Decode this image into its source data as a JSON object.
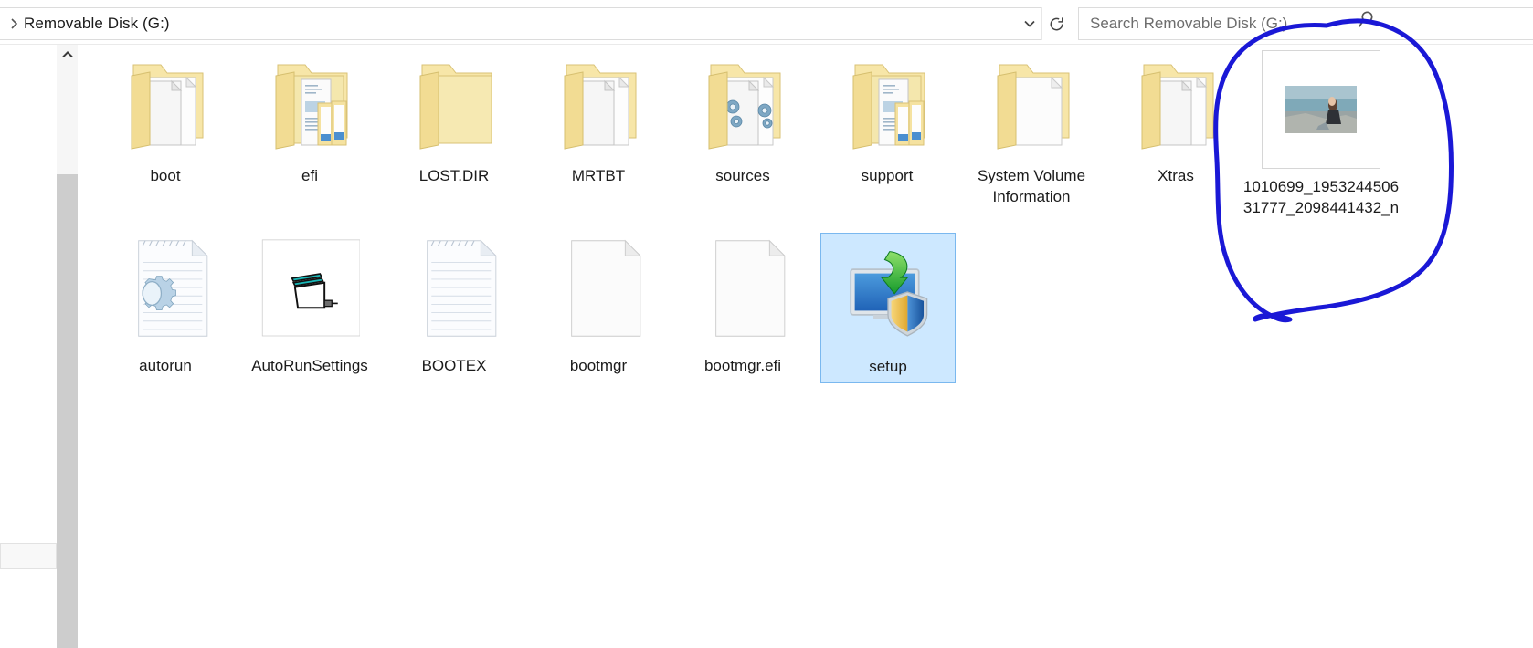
{
  "window": {
    "address": {
      "path_label": "Removable Disk (G:)",
      "expand_icon": "chevron-right-icon",
      "dropdown_icon": "chevron-down-icon",
      "refresh_icon": "refresh-icon"
    },
    "search": {
      "placeholder": "Search Removable Disk (G:)",
      "value": "",
      "icon": "search-icon"
    }
  },
  "colors": {
    "selection_fill": "#cde8ff",
    "selection_border": "#7ab8ef",
    "annotation_ink": "#1a18d6",
    "folder_yellow": "#f5dd8f",
    "text": "#1b1b1b",
    "placeholder_text": "#6d6d6d"
  },
  "scrollbar": {
    "up_arrow_icon": "chevron-up-icon",
    "orientation": "vertical"
  },
  "files": {
    "row1": [
      {
        "name": "boot",
        "icon": "folder-with-documents-icon",
        "type": "folder",
        "selected": false
      },
      {
        "name": "efi",
        "icon": "folder-with-subfolders-icon",
        "type": "folder",
        "selected": false
      },
      {
        "name": "LOST.DIR",
        "icon": "folder-empty-icon",
        "type": "folder",
        "selected": false
      },
      {
        "name": "MRTBT",
        "icon": "folder-with-documents-icon",
        "type": "folder",
        "selected": false
      },
      {
        "name": "sources",
        "icon": "folder-with-gears-icon",
        "type": "folder",
        "selected": false
      },
      {
        "name": "support",
        "icon": "folder-with-subfolders-icon",
        "type": "folder",
        "selected": false
      },
      {
        "name": "System Volume Information",
        "icon": "folder-single-document-icon",
        "type": "folder",
        "selected": false
      },
      {
        "name": "Xtras",
        "icon": "folder-with-documents-icon",
        "type": "folder",
        "selected": false
      }
    ],
    "row2": [
      {
        "name": "autorun",
        "icon": "gear-document-icon",
        "type": "file",
        "selected": false
      },
      {
        "name": "AutoRunSettings",
        "icon": "window-app-icon",
        "type": "file",
        "selected": false
      },
      {
        "name": "BOOTEX",
        "icon": "text-document-icon",
        "type": "file",
        "selected": false
      },
      {
        "name": "bootmgr",
        "icon": "blank-file-icon",
        "type": "file",
        "selected": false
      },
      {
        "name": "bootmgr.efi",
        "icon": "blank-file-icon",
        "type": "file",
        "selected": false
      },
      {
        "name": "setup",
        "icon": "setup-installer-icon",
        "type": "file",
        "selected": true
      }
    ],
    "thumbnail_item": {
      "name": "1010699_195324450631777_2098441432_n",
      "icon": "photo-thumbnail-icon",
      "type": "image",
      "selected": false,
      "thumbnail_description": "woman sitting on rocks by the sea"
    }
  },
  "annotation": {
    "shape": "hand-drawn-circle",
    "color": "#1a18d6",
    "stroke_width": 5,
    "target": "1010699_195324450631777_2098441432_n"
  }
}
